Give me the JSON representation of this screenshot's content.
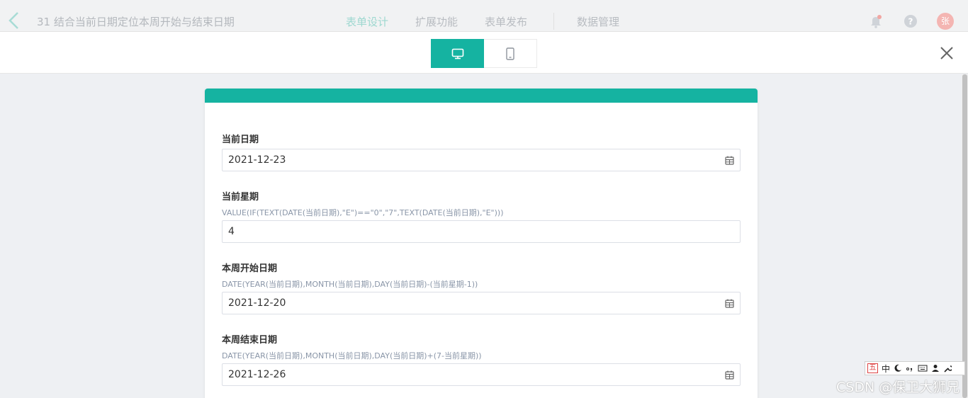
{
  "header": {
    "app_title": "31 结合当前日期定位本周开始与结束日期",
    "nav": [
      "表单设计",
      "扩展功能",
      "表单发布",
      "数据管理"
    ],
    "avatar": "张"
  },
  "preview": {
    "devices": [
      "desktop-icon",
      "mobile-icon"
    ]
  },
  "form": {
    "fields": [
      {
        "label": "当前日期",
        "formula": "",
        "value": "2021-12-23"
      },
      {
        "label": "当前星期",
        "formula": "VALUE(IF(TEXT(DATE(当前日期),\"E\")==\"0\",\"7\",TEXT(DATE(当前日期),\"E\")))",
        "value": "4"
      },
      {
        "label": "本周开始日期",
        "formula": "DATE(YEAR(当前日期),MONTH(当前日期),DAY(当前日期)-(当前星期-1))",
        "value": "2021-12-20"
      },
      {
        "label": "本周结束日期",
        "formula": "DATE(YEAR(当前日期),MONTH(当前日期),DAY(当前日期)+(7-当前星期))",
        "value": "2021-12-26"
      }
    ]
  },
  "ime": {
    "mode": "中"
  },
  "watermark": "CSDN @保卫大狮兄",
  "colors": {
    "accent": "#15b3a1",
    "label": "#333333",
    "formula": "#8a96a8"
  }
}
